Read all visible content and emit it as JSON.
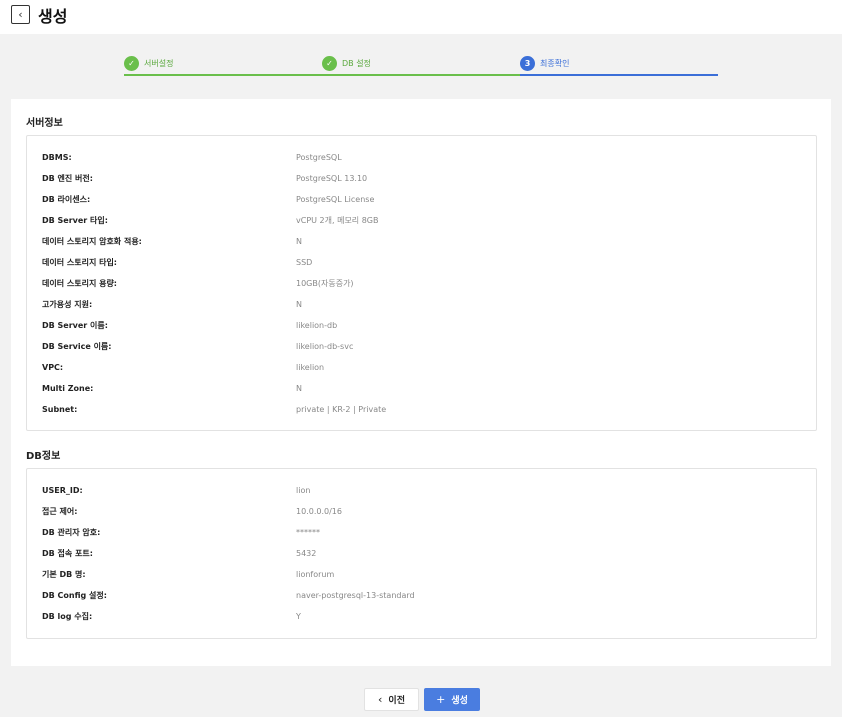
{
  "header": {
    "back_icon": "chevron-left-icon",
    "title": "생성"
  },
  "stepper": {
    "steps": [
      {
        "label": "서버설정",
        "status": "done",
        "marker": "✓"
      },
      {
        "label": "DB 설정",
        "status": "done",
        "marker": "✓"
      },
      {
        "label": "최종확인",
        "status": "active",
        "marker": "3"
      }
    ]
  },
  "server_info": {
    "title": "서버정보",
    "rows": [
      {
        "label": "DBMS:",
        "value": "PostgreSQL"
      },
      {
        "label": "DB 엔진 버전:",
        "value": "PostgreSQL 13.10"
      },
      {
        "label": "DB 라이센스:",
        "value": "PostgreSQL License"
      },
      {
        "label": "DB Server 타입:",
        "value": "vCPU 2개, 메모리 8GB"
      },
      {
        "label": "데이터 스토리지 암호화 적용:",
        "value": "N"
      },
      {
        "label": "데이터 스토리지 타입:",
        "value": "SSD"
      },
      {
        "label": "데이터 스토리지 용량:",
        "value": "10GB(자동증가)"
      },
      {
        "label": "고가용성 지원:",
        "value": "N"
      },
      {
        "label": "DB Server 이름:",
        "value": "likelion-db"
      },
      {
        "label": "DB Service 이름:",
        "value": "likelion-db-svc"
      },
      {
        "label": "VPC:",
        "value": "likelion"
      },
      {
        "label": "Multi Zone:",
        "value": "N"
      },
      {
        "label": "Subnet:",
        "value": "private | KR-2 | Private"
      }
    ]
  },
  "db_info": {
    "title": "DB정보",
    "rows": [
      {
        "label": "USER_ID:",
        "value": "lion"
      },
      {
        "label": "접근 제어:",
        "value": "10.0.0.0/16"
      },
      {
        "label": "DB 관리자 암호:",
        "value": "******"
      },
      {
        "label": "DB 접속 포트:",
        "value": "5432"
      },
      {
        "label": "기본 DB 명:",
        "value": "lionforum"
      },
      {
        "label": "DB Config 설정:",
        "value": "naver-postgresql-13-standard"
      },
      {
        "label": "DB log 수집:",
        "value": "Y"
      }
    ]
  },
  "footer": {
    "prev_icon": "‹",
    "prev_label": "이전",
    "create_icon": "+",
    "create_label": "생성"
  },
  "colors": {
    "done": "#6abf4b",
    "active": "#3b6fd8",
    "primary_button": "#4a7de0"
  }
}
